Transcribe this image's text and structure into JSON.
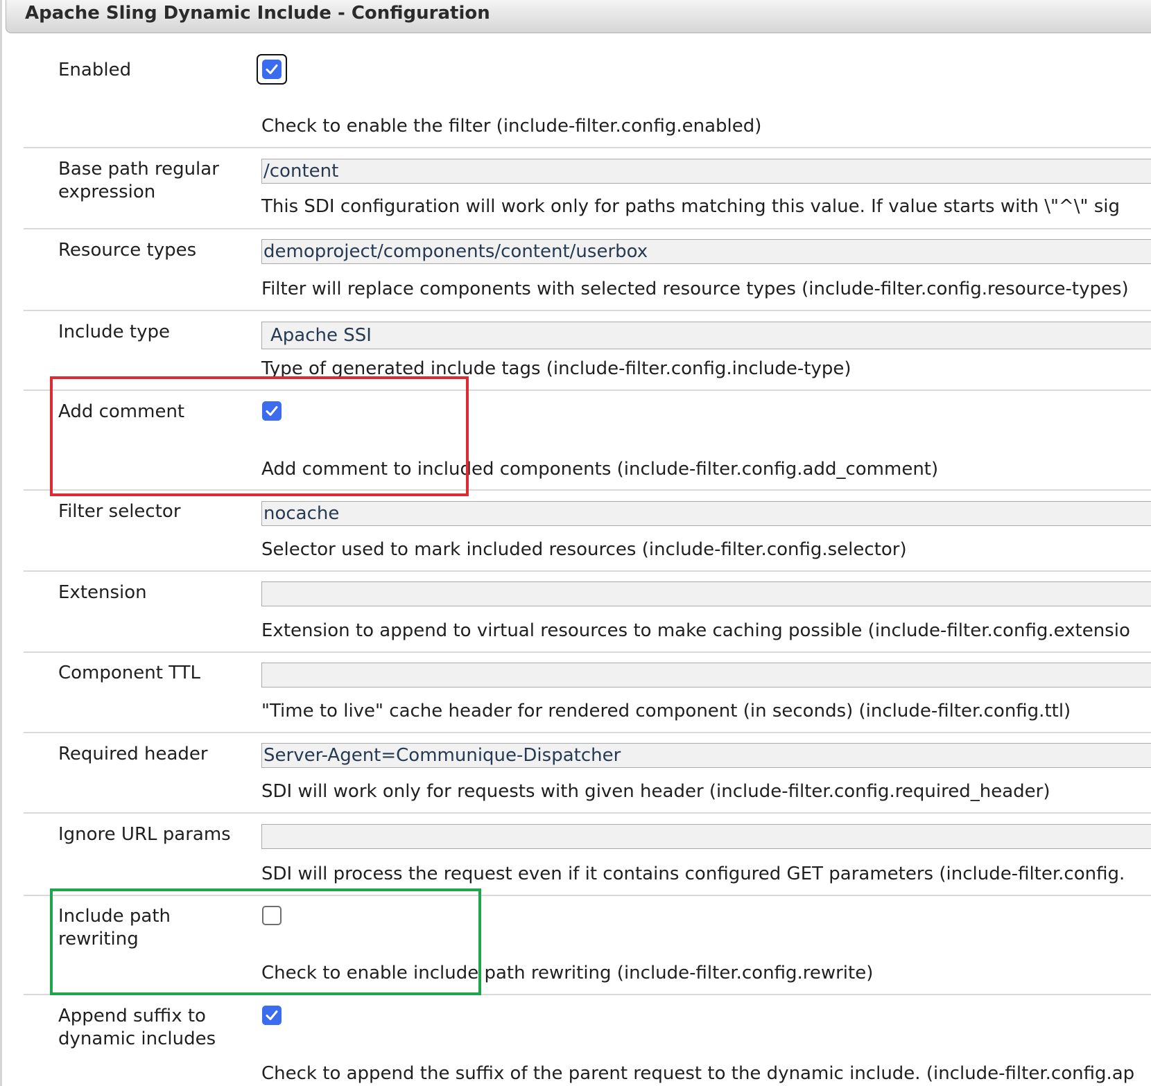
{
  "title": "Apache Sling Dynamic Include - Configuration",
  "fields": {
    "enabled": {
      "label": "Enabled",
      "checked": true,
      "description": "Check to enable the filter (include-filter.config.enabled)"
    },
    "base_path": {
      "label_line1": "Base path regular",
      "label_line2": "expression",
      "value": "/content",
      "description": "This SDI configuration will work only for paths matching this value. If value starts with \\\"^\\\" sig"
    },
    "resource_types": {
      "label": "Resource types",
      "value": "demoproject/components/content/userbox",
      "description": "Filter will replace components with selected resource types (include-filter.config.resource-types)"
    },
    "include_type": {
      "label": "Include type",
      "value": "Apache SSI",
      "description": "Type of generated include tags (include-filter.config.include-type)"
    },
    "add_comment": {
      "label": "Add comment",
      "checked": true,
      "description": "Add comment to included components (include-filter.config.add_comment)"
    },
    "filter_selector": {
      "label": "Filter selector",
      "value": "nocache",
      "description": "Selector used to mark included resources (include-filter.config.selector)"
    },
    "extension": {
      "label": "Extension",
      "value": "",
      "description": "Extension to append to virtual resources to make caching possible (include-filter.config.extensio"
    },
    "component_ttl": {
      "label": "Component TTL",
      "value": "",
      "description": "\"Time to live\" cache header for rendered component (in seconds) (include-filter.config.ttl)"
    },
    "required_header": {
      "label": "Required header",
      "value": "Server-Agent=Communique-Dispatcher",
      "description": "SDI will work only for requests with given header (include-filter.config.required_header)"
    },
    "ignore_url_params": {
      "label": "Ignore URL params",
      "value": "",
      "description": "SDI will process the request even if it contains configured GET parameters (include-filter.config."
    },
    "include_path_rewriting": {
      "label_line1": "Include path",
      "label_line2": "rewriting",
      "checked": false,
      "description": "Check to enable include path rewriting (include-filter.config.rewrite)"
    },
    "append_suffix": {
      "label_line1": "Append suffix to",
      "label_line2": "dynamic includes",
      "checked": true,
      "description": "Check to append the suffix of the parent request to the dynamic include. (include-filter.config.ap"
    }
  },
  "annotations": {
    "red_box_color": "#dd2a33",
    "green_box_color": "#1ea54e"
  },
  "colors": {
    "checkbox_checked": "#3b6cf0",
    "input_background": "#f1f1f1"
  }
}
